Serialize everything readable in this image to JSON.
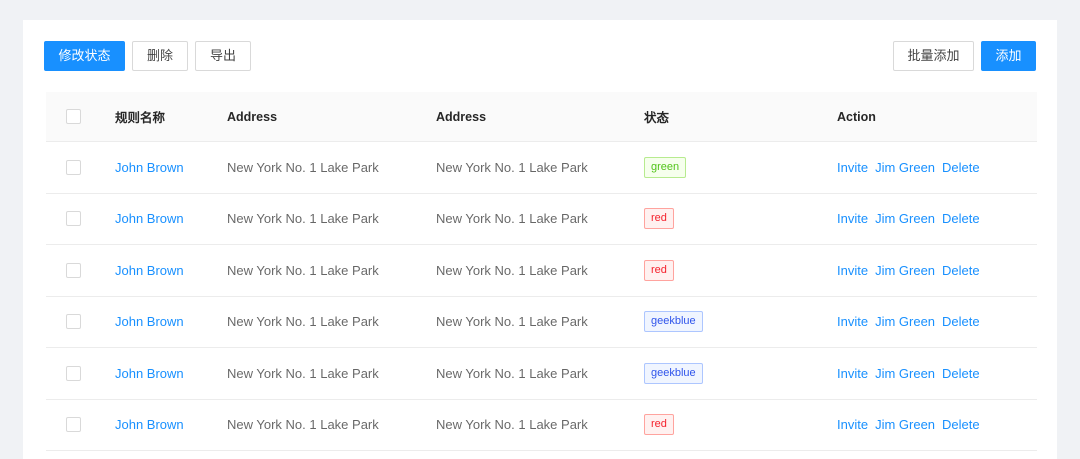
{
  "toolbar": {
    "modify_status_label": "修改状态",
    "delete_label": "删除",
    "export_label": "导出",
    "batch_add_label": "批量添加",
    "add_label": "添加"
  },
  "table": {
    "columns": {
      "name": "规则名称",
      "address1": "Address",
      "address2": "Address",
      "status": "状态",
      "action": "Action"
    },
    "rows": [
      {
        "name": "John Brown",
        "address1": "New York No. 1 Lake Park",
        "address2": "New York No. 1 Lake Park",
        "tag": "green",
        "actions": [
          "Invite",
          "Jim Green",
          "Delete"
        ]
      },
      {
        "name": "John Brown",
        "address1": "New York No. 1 Lake Park",
        "address2": "New York No. 1 Lake Park",
        "tag": "red",
        "actions": [
          "Invite",
          "Jim Green",
          "Delete"
        ]
      },
      {
        "name": "John Brown",
        "address1": "New York No. 1 Lake Park",
        "address2": "New York No. 1 Lake Park",
        "tag": "red",
        "actions": [
          "Invite",
          "Jim Green",
          "Delete"
        ]
      },
      {
        "name": "John Brown",
        "address1": "New York No. 1 Lake Park",
        "address2": "New York No. 1 Lake Park",
        "tag": "geekblue",
        "actions": [
          "Invite",
          "Jim Green",
          "Delete"
        ]
      },
      {
        "name": "John Brown",
        "address1": "New York No. 1 Lake Park",
        "address2": "New York No. 1 Lake Park",
        "tag": "geekblue",
        "actions": [
          "Invite",
          "Jim Green",
          "Delete"
        ]
      },
      {
        "name": "John Brown",
        "address1": "New York No. 1 Lake Park",
        "address2": "New York No. 1 Lake Park",
        "tag": "red",
        "actions": [
          "Invite",
          "Jim Green",
          "Delete"
        ]
      }
    ]
  },
  "colors": {
    "primary": "#1890ff",
    "page_background": "#f0f2f5",
    "tag_green": "#52c41a",
    "tag_red": "#f5222d",
    "tag_geekblue": "#2f54eb"
  }
}
